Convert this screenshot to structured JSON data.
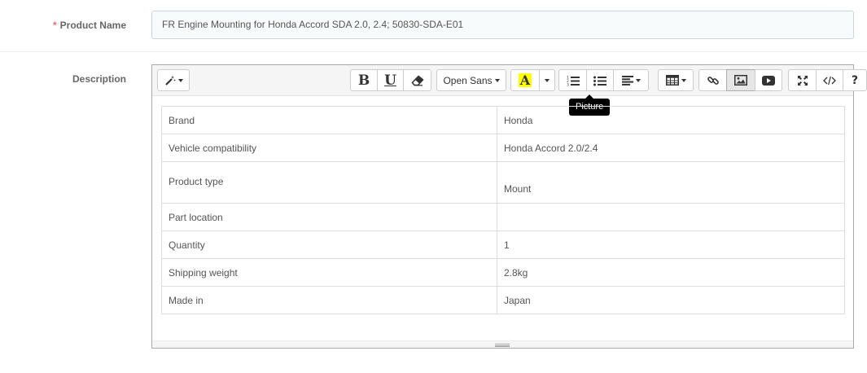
{
  "product_name": {
    "required_mark": "*",
    "label": "Product Name",
    "value": "FR Engine Mounting for Honda Accord SDA 2.0, 2.4; 50830-SDA-E01"
  },
  "description": {
    "label": "Description",
    "toolbar": {
      "font_name": "Open Sans",
      "bold_glyph": "B",
      "underline_glyph": "U",
      "color_glyph": "A",
      "help_glyph": "?",
      "highlight_color": "#ffff00"
    },
    "tooltip": "Picture",
    "table": {
      "rows": [
        {
          "key": "Brand",
          "value": "Honda"
        },
        {
          "key": "Vehicle compatibility",
          "value": "Honda Accord 2.0/2.4"
        },
        {
          "key": "Product type",
          "value": "Mount"
        },
        {
          "key": "Part location",
          "value": ""
        },
        {
          "key": "Quantity",
          "value": "1"
        },
        {
          "key": "Shipping weight",
          "value": "2.8kg"
        },
        {
          "key": "Made in",
          "value": "Japan"
        }
      ]
    }
  },
  "icons": [
    "magic-wand-icon",
    "eraser-icon",
    "ordered-list-icon",
    "unordered-list-icon",
    "align-icon",
    "table-icon",
    "link-icon",
    "picture-icon",
    "video-icon",
    "fullscreen-icon",
    "code-view-icon"
  ],
  "colors": {
    "required": "#f56b6b",
    "label": "#666666",
    "input_border": "#c7d6db"
  }
}
